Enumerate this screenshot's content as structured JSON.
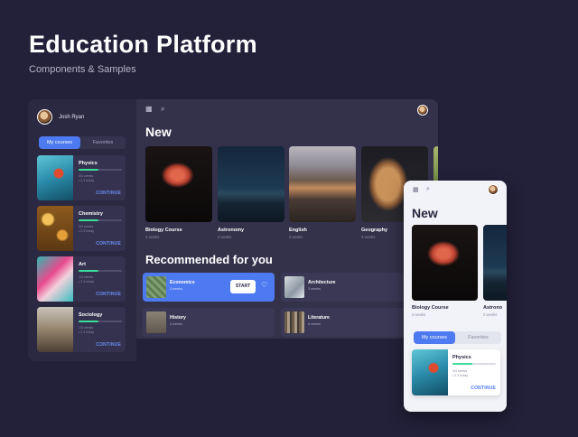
{
  "header": {
    "title": "Education Platform",
    "subtitle": "Components & Samples"
  },
  "sidebar": {
    "user_name": "Josh Ryan",
    "tabs": {
      "active": "My courses",
      "inactive": "Favorites"
    },
    "courses": [
      {
        "title": "Physics",
        "meta1": "3/4 weeks",
        "meta2": "• 2.3 h/day",
        "progress": 0.45,
        "cta": "CONTINUE"
      },
      {
        "title": "Chemistry",
        "meta1": "3/4 weeks",
        "meta2": "• 2.3 h/day",
        "progress": 0.45,
        "cta": "CONTINUE"
      },
      {
        "title": "Art",
        "meta1": "1/4 weeks",
        "meta2": "• 2.3 h/day",
        "progress": 0.45,
        "cta": "CONTINUE"
      },
      {
        "title": "Sociology",
        "meta1": "1/3 weeks",
        "meta2": "• 2.3 h/day",
        "progress": 0.45,
        "cta": "CONTINUE"
      }
    ]
  },
  "main": {
    "new_title": "New",
    "new_items": [
      {
        "title": "Biology Course",
        "meta": "4 weeks"
      },
      {
        "title": "Astronomy",
        "meta": "2 weeks"
      },
      {
        "title": "English",
        "meta": "4 weeks"
      },
      {
        "title": "Geography",
        "meta": "3 weeks"
      }
    ],
    "recommended_title": "Recommended for you",
    "recommended": [
      {
        "title": "Economics",
        "meta": "3 weeks",
        "button": "START"
      },
      {
        "title": "Architecture",
        "meta": "3 weeks"
      },
      {
        "title": "History",
        "meta": "4 weeks"
      },
      {
        "title": "Literature",
        "meta": "8 weeks"
      }
    ]
  },
  "mobile": {
    "new_title": "New",
    "new_items": [
      {
        "title": "Biology Course",
        "meta": "4 weeks"
      },
      {
        "title": "Astrono",
        "meta": "2 weeks"
      }
    ],
    "tabs": {
      "active": "My courses",
      "inactive": "Favorites"
    },
    "course": {
      "title": "Physics",
      "meta1": "3/4 weeks",
      "meta2": "• 2.3 h/day",
      "progress": 0.45,
      "cta": "CONTINUE"
    }
  },
  "icons": [
    "grid-icon",
    "search-icon",
    "heart-icon"
  ],
  "colors": {
    "background": "#23203a",
    "panel": "#34314b",
    "accent": "#4d7af0",
    "progress": "#3ddc97"
  }
}
